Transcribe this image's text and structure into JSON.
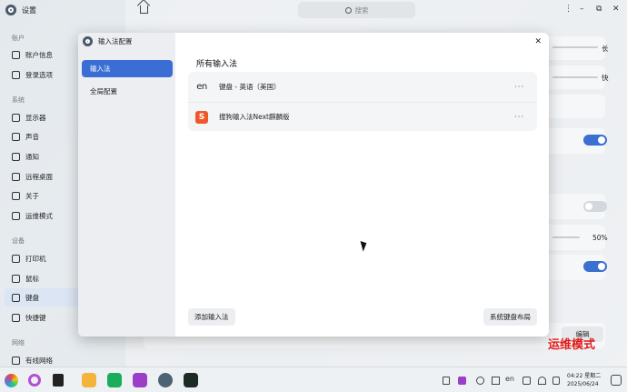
{
  "app": {
    "title": "设置"
  },
  "search": {
    "placeholder": "搜索"
  },
  "window_controls": {
    "more": "⋮",
    "minimize": "–",
    "restore": "⧉",
    "close": "✕"
  },
  "sidebar": {
    "sections": [
      {
        "label": "账户"
      },
      {
        "label": "系统"
      },
      {
        "label": "设备"
      },
      {
        "label": "网络"
      }
    ],
    "items": [
      {
        "label": "账户信息",
        "icon": "user-icon"
      },
      {
        "label": "登录选项",
        "icon": "key-icon"
      },
      {
        "label": "显示器",
        "icon": "monitor-icon"
      },
      {
        "label": "声音",
        "icon": "speaker-icon"
      },
      {
        "label": "通知",
        "icon": "bell-icon"
      },
      {
        "label": "远程桌面",
        "icon": "remote-desktop-icon"
      },
      {
        "label": "关于",
        "icon": "info-icon"
      },
      {
        "label": "运维模式",
        "icon": "maintenance-icon"
      },
      {
        "label": "打印机",
        "icon": "printer-icon"
      },
      {
        "label": "鼠标",
        "icon": "mouse-icon"
      },
      {
        "label": "键盘",
        "icon": "keyboard-icon",
        "active": true
      },
      {
        "label": "快捷键",
        "icon": "shortcut-icon"
      },
      {
        "label": "有线网络",
        "icon": "ethernet-icon"
      }
    ]
  },
  "background_settings": {
    "right_labels": [
      "长",
      "快"
    ],
    "slider_value": "50%",
    "edit_button": "编辑"
  },
  "dialog": {
    "title": "输入法配置",
    "nav": [
      {
        "label": "输入法",
        "active": true
      },
      {
        "label": "全局配置",
        "active": false
      }
    ],
    "heading": "所有输入法",
    "input_methods": [
      {
        "label": "键盘 - 英语（美国）",
        "icon": "en-keyboard-icon",
        "glyph": "en"
      },
      {
        "label": "搜狗输入法Next麒麟版",
        "icon": "sogou-icon",
        "glyph": "S"
      }
    ],
    "more_glyph": "···",
    "add_button": "添加输入法",
    "layout_button": "系统键盘布局",
    "close_glyph": "✕"
  },
  "watermark": "运维模式",
  "taskbar": {
    "clock_time": "04:22 星期二",
    "clock_date": "2025/06/24",
    "tray_lang": "en"
  },
  "colors": {
    "accent": "#3a6ed4",
    "watermark": "#e01818"
  }
}
